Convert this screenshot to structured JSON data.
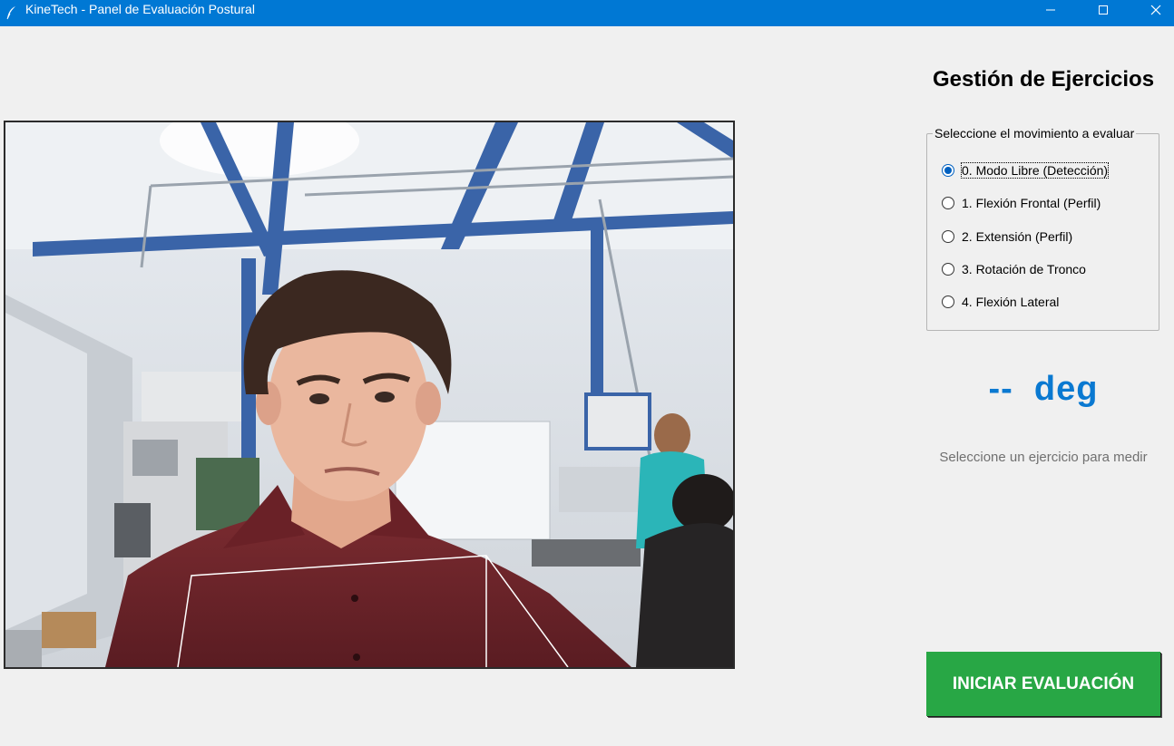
{
  "window": {
    "title": "KineTech - Panel de Evaluación Postural",
    "controls": [
      "minimize-icon",
      "maximize-icon",
      "close-icon"
    ],
    "titlebar_color": "#0078d4"
  },
  "camera": {
    "feed": "webcam-live-view"
  },
  "panel": {
    "title": "Gestión de Ejercicios",
    "group_label": "Seleccione el movimiento a evaluar",
    "options": [
      {
        "label": "0. Modo Libre (Detección)",
        "selected": true
      },
      {
        "label": "1. Flexión Frontal (Perfil)",
        "selected": false
      },
      {
        "label": "2. Extensión (Perfil)",
        "selected": false
      },
      {
        "label": "3. Rotación de Tronco",
        "selected": false
      },
      {
        "label": "4. Flexión Lateral",
        "selected": false
      }
    ],
    "angle_display": "--  deg",
    "status_text": "Seleccione un ejercicio para medir",
    "start_button": "INICIAR EVALUACIÓN",
    "accent_color": "#0a79d1",
    "button_color": "#28a745"
  }
}
